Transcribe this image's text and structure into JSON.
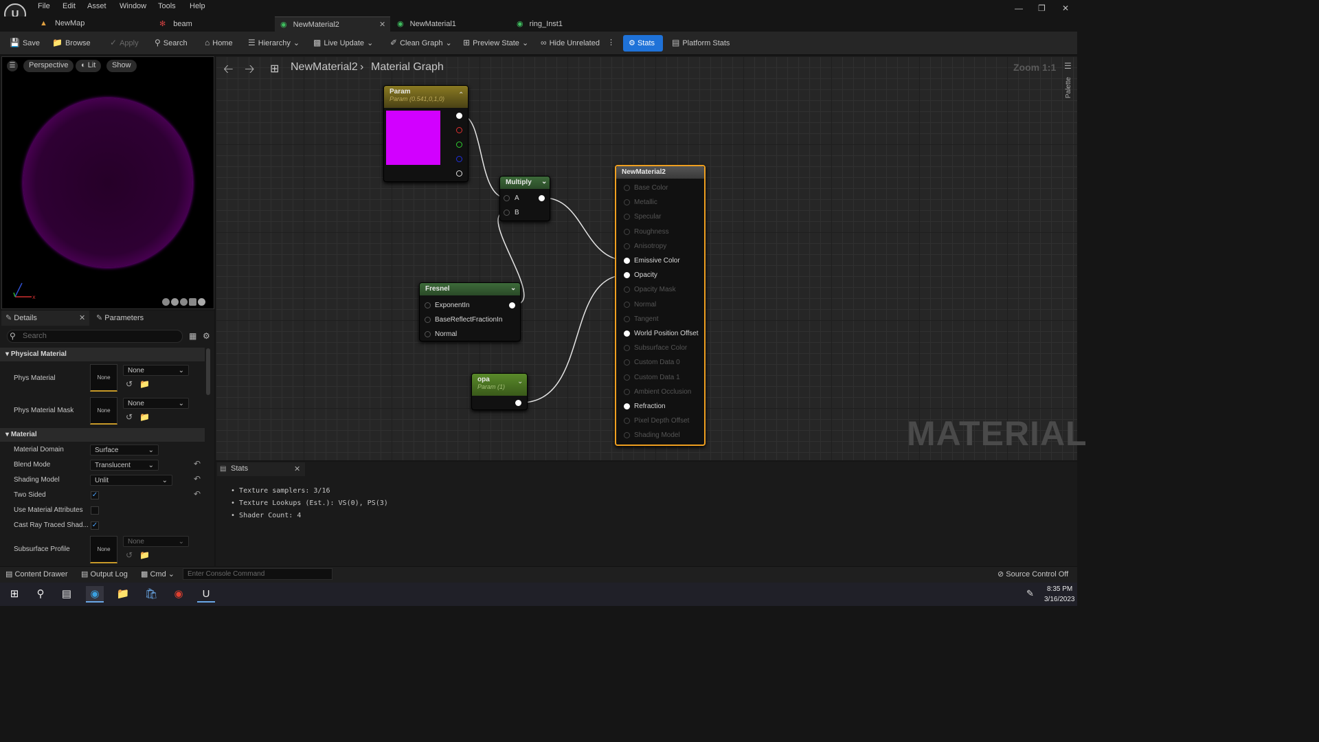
{
  "menu": {
    "logo": "U",
    "items": [
      "File",
      "Edit",
      "Asset",
      "Window",
      "Tools",
      "Help"
    ]
  },
  "tabs": [
    {
      "label": "NewMap",
      "icon": "map-icon"
    },
    {
      "label": "beam",
      "icon": "particle-icon"
    },
    {
      "label": "NewMaterial2",
      "icon": "material-icon"
    },
    {
      "label": "NewMaterial1",
      "icon": "material-icon"
    },
    {
      "label": "ring_Inst1",
      "icon": "material-instance-icon"
    }
  ],
  "toolbar": {
    "save": "Save",
    "browse": "Browse",
    "apply": "Apply",
    "search": "Search",
    "home": "Home",
    "hierarchy": "Hierarchy",
    "live_update": "Live Update",
    "clean_graph": "Clean Graph",
    "preview_state": "Preview State",
    "hide_unrelated": "Hide Unrelated",
    "stats": "Stats",
    "platform_stats": "Platform Stats"
  },
  "viewport": {
    "perspective": "Perspective",
    "lit": "Lit",
    "show": "Show"
  },
  "details": {
    "tab_details": "Details",
    "tab_parameters": "Parameters",
    "search_placeholder": "Search",
    "sections": {
      "physical_material": "Physical Material",
      "material": "Material"
    },
    "phys_material": {
      "label": "Phys Material",
      "thumb": "None",
      "value": "None"
    },
    "phys_material_mask": {
      "label": "Phys Material Mask",
      "thumb": "None",
      "value": "None"
    },
    "material_domain": {
      "label": "Material Domain",
      "value": "Surface"
    },
    "blend_mode": {
      "label": "Blend Mode",
      "value": "Translucent"
    },
    "shading_model": {
      "label": "Shading Model",
      "value": "Unlit"
    },
    "two_sided": {
      "label": "Two Sided",
      "checked": true
    },
    "use_material_attributes": {
      "label": "Use Material Attributes",
      "checked": false
    },
    "cast_ray_traced": {
      "label": "Cast Ray Traced Shad...",
      "checked": true
    },
    "subsurface_profile": {
      "label": "Subsurface Profile",
      "thumb": "None",
      "value": "None"
    }
  },
  "graph": {
    "breadcrumb_root": "NewMaterial2",
    "breadcrumb_page": "Material Graph",
    "zoom": "Zoom 1:1",
    "watermark": "MATERIAL",
    "palette": "Palette",
    "param_node": {
      "title": "Param",
      "subtitle": "Param (0.541,0,1,0)",
      "color": "#d200ff"
    },
    "multiply_node": {
      "title": "Multiply",
      "pin_a": "A",
      "pin_b": "B"
    },
    "fresnel_node": {
      "title": "Fresnel",
      "pins": [
        "ExponentIn",
        "BaseReflectFractionIn",
        "Normal"
      ]
    },
    "opa_node": {
      "title": "opa",
      "subtitle": "Param (1)"
    },
    "result_node": {
      "title": "NewMaterial2",
      "pins": [
        {
          "label": "Base Color",
          "active": false
        },
        {
          "label": "Metallic",
          "active": false
        },
        {
          "label": "Specular",
          "active": false
        },
        {
          "label": "Roughness",
          "active": false
        },
        {
          "label": "Anisotropy",
          "active": false
        },
        {
          "label": "Emissive Color",
          "active": true
        },
        {
          "label": "Opacity",
          "active": true
        },
        {
          "label": "Opacity Mask",
          "active": false
        },
        {
          "label": "Normal",
          "active": false
        },
        {
          "label": "Tangent",
          "active": false
        },
        {
          "label": "World Position Offset",
          "active": true
        },
        {
          "label": "Subsurface Color",
          "active": false
        },
        {
          "label": "Custom Data 0",
          "active": false
        },
        {
          "label": "Custom Data 1",
          "active": false
        },
        {
          "label": "Ambient Occlusion",
          "active": false
        },
        {
          "label": "Refraction",
          "active": true
        },
        {
          "label": "Pixel Depth Offset",
          "active": false
        },
        {
          "label": "Shading Model",
          "active": false
        }
      ]
    }
  },
  "stats": {
    "tab": "Stats",
    "lines": [
      "Texture samplers: 3/16",
      "Texture Lookups (Est.): VS(0), PS(3)",
      "Shader Count: 4"
    ]
  },
  "bottombar": {
    "content_drawer": "Content Drawer",
    "output_log": "Output Log",
    "cmd": "Cmd",
    "console_placeholder": "Enter Console Command",
    "source_control": "Source Control Off"
  },
  "taskbar": {
    "time": "8:35 PM",
    "date": "3/16/2023"
  }
}
